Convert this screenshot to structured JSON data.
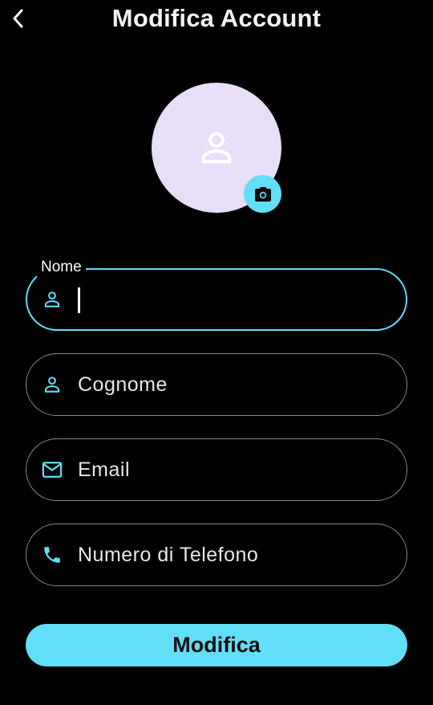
{
  "header": {
    "title": "Modifica Account",
    "back_icon": "chevron-left-icon"
  },
  "avatar": {
    "icon": "person-icon",
    "edit_icon": "camera-icon",
    "background": "#e8def8"
  },
  "form": {
    "fields": [
      {
        "label": "Nome",
        "placeholder": "",
        "value": "",
        "icon": "person-icon",
        "focused": true
      },
      {
        "label": "",
        "placeholder": "Cognome",
        "value": "",
        "icon": "person-icon",
        "focused": false
      },
      {
        "label": "",
        "placeholder": "Email",
        "value": "",
        "icon": "mail-icon",
        "focused": false
      },
      {
        "label": "",
        "placeholder": "Numero di Telefono",
        "value": "",
        "icon": "phone-icon",
        "focused": false
      }
    ],
    "submit_label": "Modifica"
  },
  "colors": {
    "accent": "#61def8",
    "background": "#000000",
    "field_border": "#8a8a8a"
  }
}
